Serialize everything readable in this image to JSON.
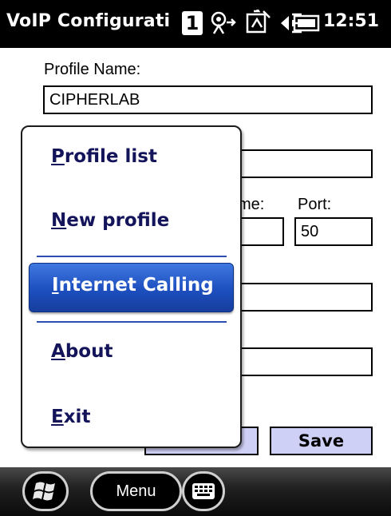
{
  "statusbar": {
    "title": "VoIP Configurati",
    "tray_number": "1",
    "time": "12:51",
    "icons": [
      "connectivity-icon",
      "sync-icon",
      "speaker-icon",
      "battery-icon"
    ]
  },
  "form": {
    "profile_name_label": "Profile Name:",
    "profile_name_value": "CIPHERLAB",
    "partial_label": "me:",
    "port_label": "Port:",
    "port_value": "50",
    "save_label": "Save"
  },
  "menu": {
    "items": [
      {
        "label": "Profile list",
        "accel": "P",
        "rest": "rofile list"
      },
      {
        "label": "New profile",
        "accel": "N",
        "rest": "ew profile"
      },
      {
        "label": "Internet Calling",
        "accel": "I",
        "rest": "nternet Calling",
        "selected": true
      },
      {
        "label": "About",
        "accel": "A",
        "rest": "bout"
      },
      {
        "label": "Exit",
        "accel": "E",
        "rest": "xit"
      }
    ]
  },
  "bottombar": {
    "start_icon": "windows-start-icon",
    "menu_label": "Menu",
    "keyboard_icon": "keyboard-icon"
  },
  "colors": {
    "menu_text": "#13145a",
    "menu_selected": "#1d4fbf",
    "button_fill": "#cfd0f6"
  }
}
